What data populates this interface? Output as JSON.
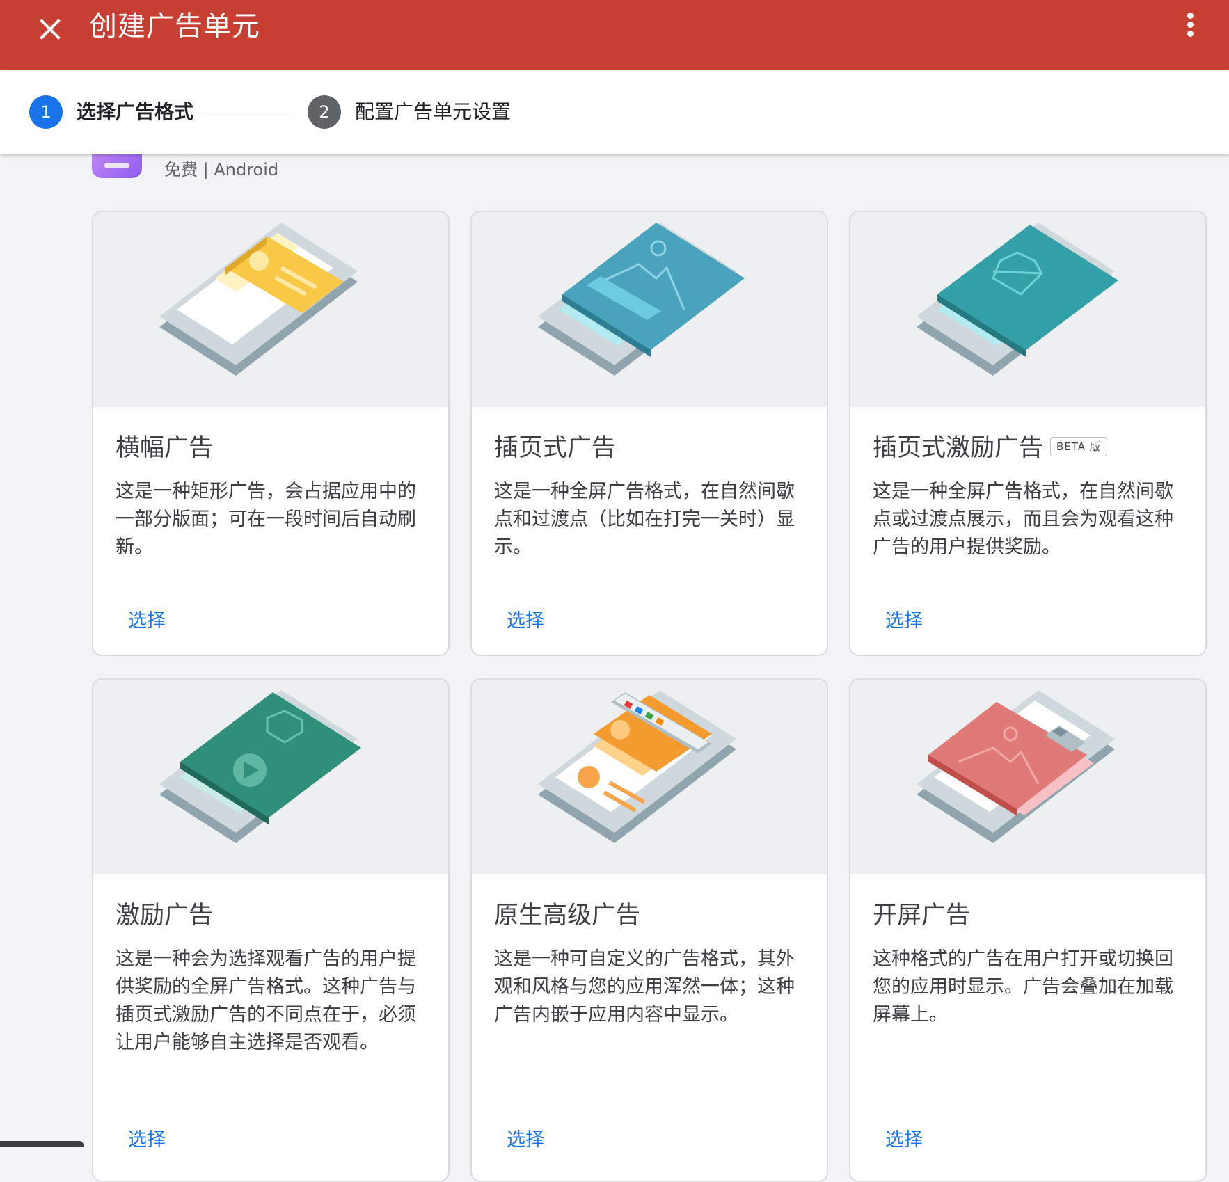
{
  "header": {
    "title": "创建广告单元",
    "close_icon": "close-icon",
    "menu_icon": "more-vert-icon",
    "background_color": "#c73e32"
  },
  "stepper": {
    "steps": [
      {
        "number": "1",
        "label": "选择广告格式",
        "state": "active"
      },
      {
        "number": "2",
        "label": "配置广告单元设置",
        "state": "inactive"
      }
    ],
    "active_color": "#1a73e8"
  },
  "app_info": {
    "meta": "免费 | Android"
  },
  "ad_formats": [
    {
      "title": "横幅广告",
      "description": "这是一种矩形广告，会占据应用中的一部分版面；可在一段时间后自动刷新。",
      "action": "选择"
    },
    {
      "title": "插页式广告",
      "description": "这是一种全屏广告格式，在自然间歇点和过渡点（比如在打完一关时）显示。",
      "action": "选择"
    },
    {
      "title": "插页式激励广告",
      "badge": "BETA 版",
      "description": "这是一种全屏广告格式，在自然间歇点或过渡点展示，而且会为观看这种广告的用户提供奖励。",
      "action": "选择"
    },
    {
      "title": "激励广告",
      "description": "这是一种会为选择观看广告的用户提供奖励的全屏广告格式。这种广告与插页式激励广告的不同点在于，必须让用户能够自主选择是否观看。",
      "action": "选择"
    },
    {
      "title": "原生高级广告",
      "description": "这是一种可自定义的广告格式，其外观和风格与您的应用浑然一体；这种广告内嵌于应用内容中显示。",
      "action": "选择"
    },
    {
      "title": "开屏广告",
      "description": "这种格式的广告在用户打开或切换回您的应用时显示。广告会叠加在加载屏幕上。",
      "action": "选择"
    }
  ],
  "link_color": "#1a73e8"
}
